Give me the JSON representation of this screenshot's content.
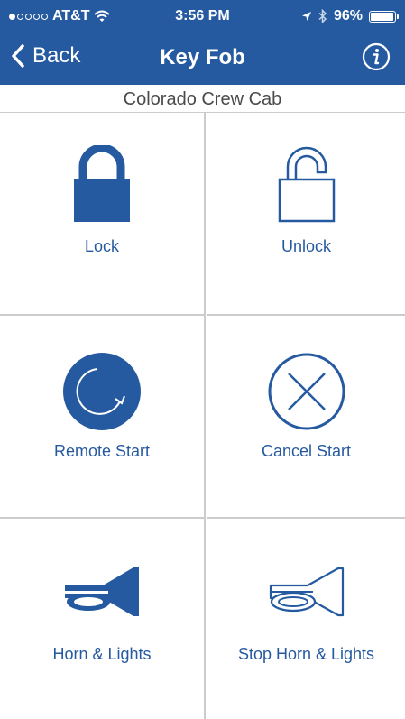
{
  "status_bar": {
    "carrier": "AT&T",
    "time": "3:56 PM",
    "battery": "96%",
    "battery_level": 0.96
  },
  "nav": {
    "back_label": "Back",
    "title": "Key Fob"
  },
  "subtitle": "Colorado Crew Cab",
  "actions": [
    {
      "label": "Lock",
      "icon": "lock-icon"
    },
    {
      "label": "Unlock",
      "icon": "unlock-icon"
    },
    {
      "label": "Remote Start",
      "icon": "remote-start-icon"
    },
    {
      "label": "Cancel Start",
      "icon": "cancel-start-icon"
    },
    {
      "label": "Horn & Lights",
      "icon": "horn-icon"
    },
    {
      "label": "Stop Horn & Lights",
      "icon": "stop-horn-icon"
    }
  ],
  "colors": {
    "brand_blue": "#265aa0",
    "divider": "#cccccc",
    "subtitle_text": "#4a4a4a"
  }
}
